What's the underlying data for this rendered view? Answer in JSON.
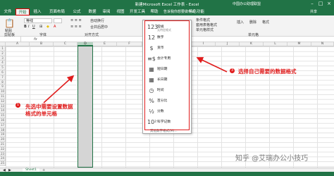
{
  "window": {
    "title": "新建Microsoft Excel 工作表 - Excel",
    "user": "中国办公助理联盟"
  },
  "tabs": [
    {
      "label": "文件"
    },
    {
      "label": "开始"
    },
    {
      "label": "插入"
    },
    {
      "label": "页面布局"
    },
    {
      "label": "公式"
    },
    {
      "label": "数据"
    },
    {
      "label": "审阅"
    },
    {
      "label": "视图"
    },
    {
      "label": "开发工具"
    },
    {
      "label": "帮助"
    },
    {
      "label": "特色功能"
    }
  ],
  "tellme": "告诉我你想要做什么",
  "share": "共享",
  "ribbon": {
    "font_name": "等线",
    "paste_label": "粘贴",
    "wrap_label": "自动换行",
    "merge_label": "合并后居中",
    "clipboard_group": "剪贴板",
    "font_group": "字体",
    "align_group": "对齐方式",
    "cond_format": "条件格式",
    "table_format": "套用表格格式",
    "cell_style": "单元格样式",
    "insert": "插入",
    "delete": "删除",
    "format": "格式",
    "cells_group": "单元格"
  },
  "formula_bar": {
    "fx": "fx"
  },
  "grid": {
    "columns": [
      "A",
      "B",
      "C",
      "D",
      "E",
      "F",
      "G",
      "H",
      "I",
      "J",
      "K",
      "L",
      "M",
      "N"
    ],
    "rows": [
      "1",
      "2",
      "3",
      "4",
      "5",
      "6",
      "7",
      "8",
      "9",
      "10",
      "11",
      "12",
      "13",
      "14",
      "15",
      "16",
      "17",
      "18",
      "19",
      "20",
      "21",
      "22",
      "23",
      "24",
      "25"
    ]
  },
  "dropdown": {
    "items": [
      {
        "icon": "123",
        "label": "常规",
        "sub": "无特定格式"
      },
      {
        "icon": "12",
        "label": "数字",
        "sub": ""
      },
      {
        "icon": "$",
        "label": "货币",
        "sub": ""
      },
      {
        "icon": "≡$",
        "label": "会计专用",
        "sub": ""
      },
      {
        "icon": "▦",
        "label": "短日期",
        "sub": ""
      },
      {
        "icon": "▦",
        "label": "长日期",
        "sub": ""
      },
      {
        "icon": "◷",
        "label": "时间",
        "sub": ""
      },
      {
        "icon": "%",
        "label": "百分比",
        "sub": ""
      },
      {
        "icon": "½",
        "label": "分数",
        "sub": ""
      },
      {
        "icon": "10²",
        "label": "科学记数",
        "sub": ""
      }
    ],
    "more": "其他数字格式(M)..."
  },
  "annotations": {
    "left_badge": "1",
    "left_text": "先选中需要设置数据格式的单元格",
    "right_badge": "3",
    "right_text": "选择自己需要的数据格式",
    "color": "#e01c1c"
  },
  "sheet": {
    "tab": "Sheet1",
    "add": "+"
  },
  "watermark": "知乎 @艾瑞办公小技巧"
}
